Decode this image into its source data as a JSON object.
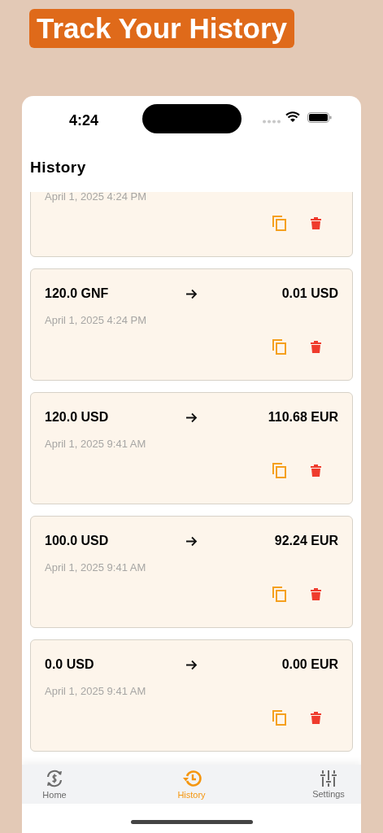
{
  "banner": {
    "title": "Track Your History"
  },
  "status_bar": {
    "time": "4:24"
  },
  "header": {
    "title": "History"
  },
  "conversions": [
    {
      "date": "April 1, 2025 4:24 PM"
    },
    {
      "from": "120.0 GNF",
      "to": "0.01 USD",
      "date": "April 1, 2025 4:24 PM"
    },
    {
      "from": "120.0 USD",
      "to": "110.68 EUR",
      "date": "April 1, 2025 9:41 AM"
    },
    {
      "from": "100.0 USD",
      "to": "92.24 EUR",
      "date": "April 1, 2025 9:41 AM"
    },
    {
      "from": "0.0 USD",
      "to": "0.00 EUR",
      "date": "April 1, 2025 9:41 AM"
    }
  ],
  "tabs": [
    {
      "kind": "home",
      "label": "Home",
      "selected": false
    },
    {
      "kind": "history",
      "label": "History",
      "selected": true
    },
    {
      "kind": "settings",
      "label": "Settings",
      "selected": false
    }
  ]
}
